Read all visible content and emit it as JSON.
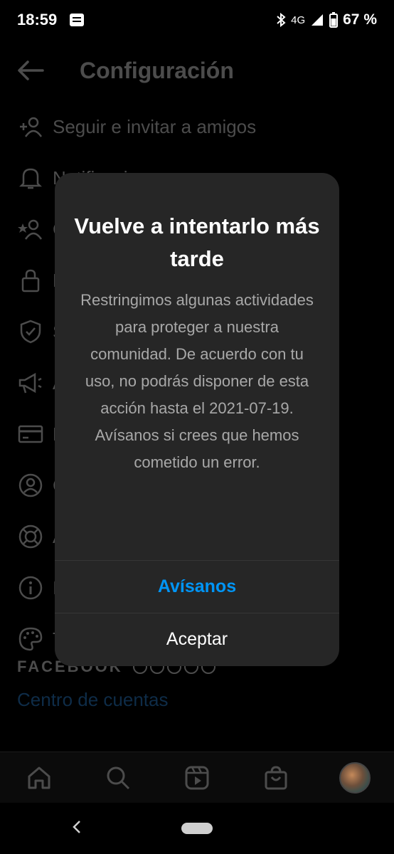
{
  "status_bar": {
    "time": "18:59",
    "network": "4G",
    "battery": "67 %"
  },
  "settings": {
    "title": "Configuración",
    "menu": [
      {
        "label": "Seguir e invitar a amigos",
        "icon": "add-person-icon"
      },
      {
        "label": "Notificaciones",
        "icon": "bell-icon"
      },
      {
        "label": "C",
        "icon": "close-friends-icon"
      },
      {
        "label": "P",
        "icon": "lock-icon"
      },
      {
        "label": "S",
        "icon": "shield-icon"
      },
      {
        "label": "A",
        "icon": "megaphone-icon"
      },
      {
        "label": "P",
        "icon": "card-icon"
      },
      {
        "label": "C",
        "icon": "account-icon"
      },
      {
        "label": "A",
        "icon": "help-icon"
      },
      {
        "label": "I",
        "icon": "info-icon"
      },
      {
        "label": "T",
        "icon": "palette-icon"
      }
    ],
    "facebook_label": "FACEBOOK",
    "accounts_center": "Centro de cuentas"
  },
  "dialog": {
    "title": "Vuelve a intentarlo más tarde",
    "body": "Restringimos algunas actividades para proteger a nuestra comunidad. De acuerdo con tu uso, no podrás disponer de esta acción hasta el 2021-07-19. Avísanos si crees que hemos cometido un error.",
    "primary_button": "Avísanos",
    "secondary_button": "Aceptar"
  },
  "colors": {
    "primary_blue": "#0095f6",
    "dialog_bg": "#262626",
    "backdrop": "#000000"
  }
}
